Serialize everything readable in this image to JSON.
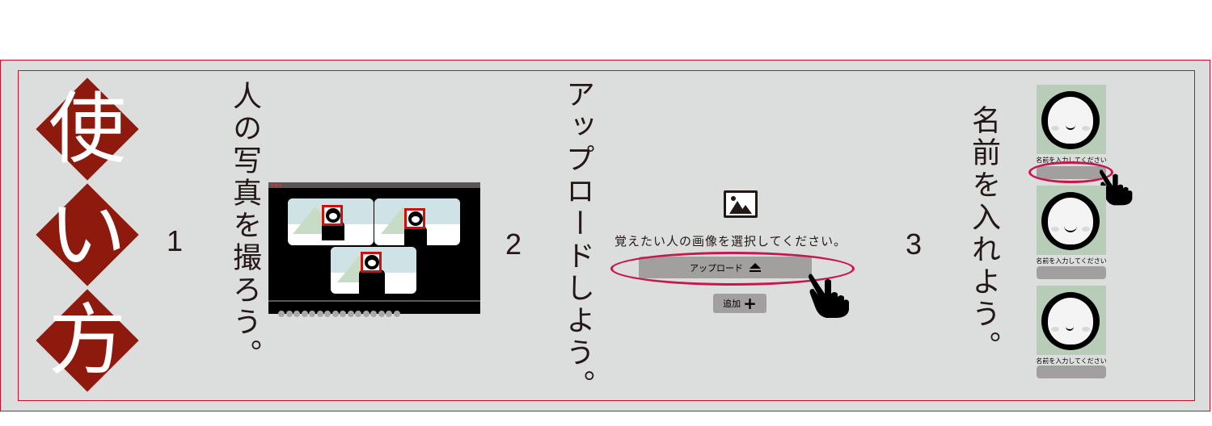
{
  "title_chars": [
    "使",
    "い",
    "方"
  ],
  "steps": [
    {
      "number": "1",
      "text": "人の写真を撮ろう。"
    },
    {
      "number": "2",
      "text": "アップロードしよう。"
    },
    {
      "number": "3",
      "text": "名前を入れよう。"
    }
  ],
  "upload_demo": {
    "prompt": "覚えたい人の画像を選択してください。",
    "upload_label": "アップロード",
    "add_label": "追加"
  },
  "name_cards": [
    {
      "label": "名前を入力してください"
    },
    {
      "label": "名前を入力してください"
    },
    {
      "label": "名前を入力してください"
    }
  ],
  "colors": {
    "accent_red": "#8e1a0e",
    "frame_red": "#c8102e",
    "highlight_pink": "#c8174e",
    "panel_bg": "#dcdddd",
    "button_gray": "#a29f9f",
    "card_green": "#b7cdb8"
  },
  "icons": {
    "image": "image-icon",
    "eject": "eject-icon",
    "plus": "plus-icon",
    "pointer": "pointing-hand-icon"
  }
}
